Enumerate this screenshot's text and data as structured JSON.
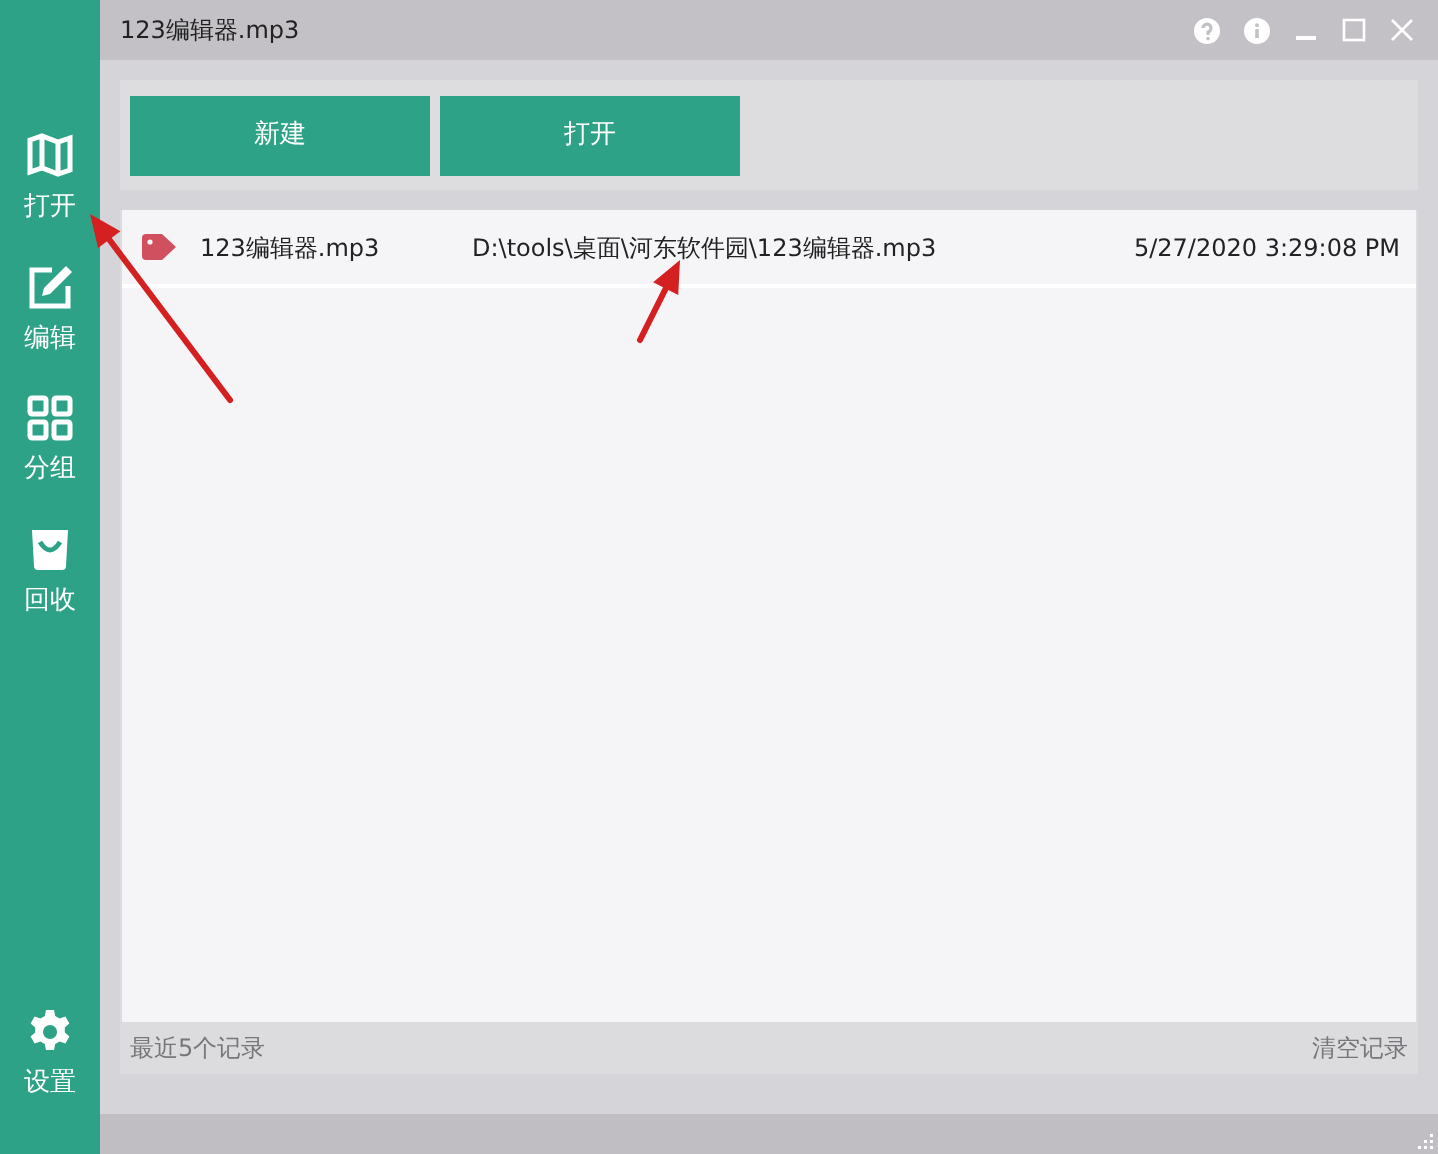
{
  "window": {
    "title": "123编辑器.mp3"
  },
  "sidebar": {
    "items": [
      {
        "label": "打开",
        "kind": "book"
      },
      {
        "label": "编辑",
        "kind": "edit"
      },
      {
        "label": "分组",
        "kind": "grid"
      },
      {
        "label": "回收",
        "kind": "bag"
      }
    ],
    "bottom_item": {
      "label": "设置",
      "kind": "gear"
    }
  },
  "toolbar": {
    "buttons": [
      "新建",
      "打开"
    ]
  },
  "records": [
    {
      "name": "123编辑器.mp3",
      "path": "D:\\tools\\桌面\\河东软件园\\123编辑器.mp3",
      "time": "5/27/2020 3:29:08 PM"
    }
  ],
  "footer": {
    "summary": "最近5个记录",
    "clear": "清空记录"
  },
  "annotations": [
    {
      "kind": "arrow"
    },
    {
      "kind": "arrow"
    }
  ]
}
